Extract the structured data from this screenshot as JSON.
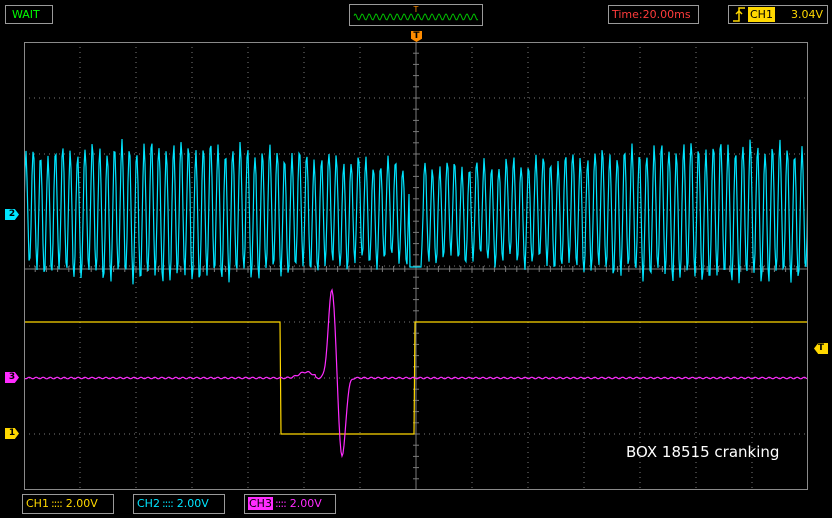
{
  "header": {
    "status": "WAIT",
    "trigger_position_label": "T",
    "timebase": "Time:20.00ms",
    "trigger_source": "CH1",
    "trigger_level": "3.04V"
  },
  "markers": {
    "trigger_time": "T",
    "ch2_ground": "2",
    "ch3_ground": "3",
    "ch1_ground": "1",
    "trigger_level": "T"
  },
  "footer": {
    "ch1": {
      "label": "CH1",
      "coupling": "::::",
      "scale": "2.00V"
    },
    "ch2": {
      "label": "CH2",
      "coupling": "::::",
      "scale": "2.00V"
    },
    "ch3": {
      "label": "CH3",
      "coupling": "::::",
      "scale": "2.00V"
    }
  },
  "annotation": "BOX 18515 cranking",
  "colors": {
    "ch1": "#ffd800",
    "ch2": "#00e5ff",
    "ch3": "#ff2cff",
    "trigger_marker": "#ff8c00",
    "grid": "#7a7a7a",
    "status": "#00ff00",
    "timebase": "#ff3b3b"
  }
}
